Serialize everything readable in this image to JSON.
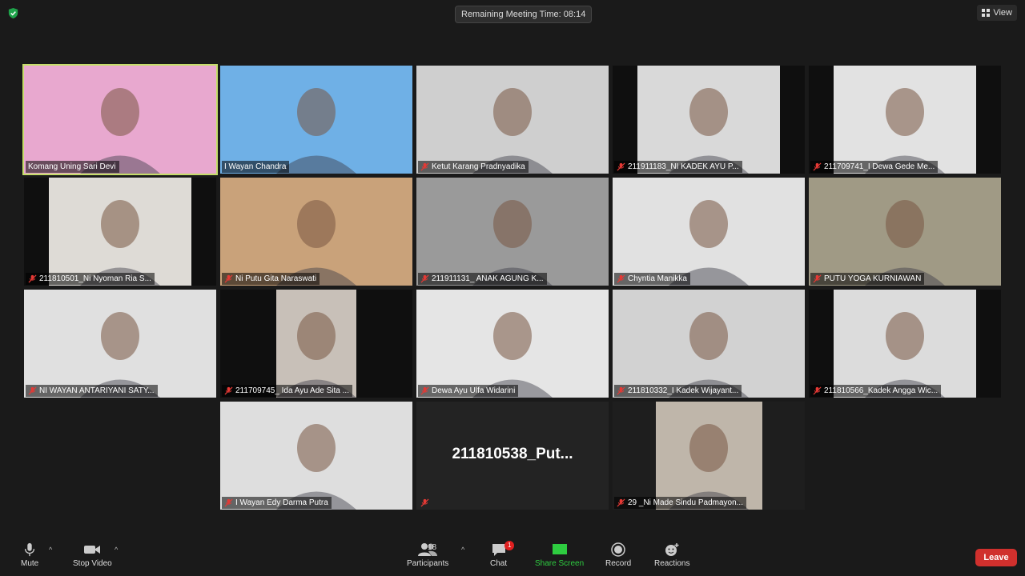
{
  "header": {
    "timer_text": "Remaining Meeting Time: 08:14",
    "view_label": "View"
  },
  "participants": [
    {
      "name": "Komang Uning Sari Devi",
      "muted": false,
      "active": true,
      "bg": "#d77eae",
      "video_color": "#e8a8cf"
    },
    {
      "name": "I Wayan Chandra",
      "muted": false,
      "active": false,
      "bg": "#5a9bd8",
      "video_color": "#6fb0e6"
    },
    {
      "name": "Ketut Karang Pradnyadika",
      "muted": true,
      "active": false,
      "bg": "#bdbdbd",
      "video_color": "#cfcfcf"
    },
    {
      "name": "211911183_NI KADEK AYU P...",
      "muted": true,
      "active": false,
      "bg": "#0f0f0f",
      "video_color": "#d9d9d9"
    },
    {
      "name": "211709741_I Dewa Gede Me...",
      "muted": true,
      "active": false,
      "bg": "#0f0f0f",
      "video_color": "#e2e2e2"
    },
    {
      "name": "211810501_Ni Nyoman Ria S...",
      "muted": true,
      "active": false,
      "bg": "#0f0f0f",
      "video_color": "#dedbd6"
    },
    {
      "name": "Ni Putu Gita Naraswati",
      "muted": true,
      "active": false,
      "bg": "#c9a27a",
      "video_color": "#c9a27a"
    },
    {
      "name": "211911131_ ANAK AGUNG K...",
      "muted": true,
      "active": false,
      "bg": "#909090",
      "video_color": "#9a9a9a"
    },
    {
      "name": "Chyntia Manikka",
      "muted": true,
      "active": false,
      "bg": "#d8d8d8",
      "video_color": "#e1e1e1"
    },
    {
      "name": "PUTU YOGA KURNIAWAN",
      "muted": true,
      "active": false,
      "bg": "#8a8a78",
      "video_color": "#a09a85"
    },
    {
      "name": "NI WAYAN ANTARIYANI SATY...",
      "muted": true,
      "active": false,
      "bg": "#d6d6d6",
      "video_color": "#e0e0e0"
    },
    {
      "name": "211709745_ Ida Ayu Ade Sita ...",
      "muted": true,
      "active": false,
      "bg": "#0f0f0f",
      "video_color": "#c8c0b8"
    },
    {
      "name": "Dewa Ayu Ulfa Widarini",
      "muted": true,
      "active": false,
      "bg": "#dcdcdc",
      "video_color": "#e5e5e5"
    },
    {
      "name": "211810332_I Kadek Wijayant...",
      "muted": true,
      "active": false,
      "bg": "#c9c9c9",
      "video_color": "#d2d2d2"
    },
    {
      "name": "211810566_Kadek Angga Wic...",
      "muted": true,
      "active": false,
      "bg": "#0f0f0f",
      "video_color": "#dcdcdc"
    },
    {
      "name": "I Wayan Edy Darma Putra",
      "muted": true,
      "active": false,
      "bg": "#d5d5d5",
      "video_color": "#dedede"
    },
    {
      "name": "",
      "muted": true,
      "active": false,
      "bg": "#232323",
      "video_color": "",
      "display_name": "211810538_Put..."
    },
    {
      "name": "29 _Ni Made Sindu Padmayon...",
      "muted": true,
      "active": false,
      "bg": "#1e1e1e",
      "video_color": "#bfb6aa"
    }
  ],
  "toolbar": {
    "mute_label": "Mute",
    "video_label": "Stop Video",
    "participants_label": "Participants",
    "participants_count": "18",
    "chat_label": "Chat",
    "chat_badge": "1",
    "share_label": "Share Screen",
    "record_label": "Record",
    "reactions_label": "Reactions",
    "leave_label": "Leave"
  }
}
